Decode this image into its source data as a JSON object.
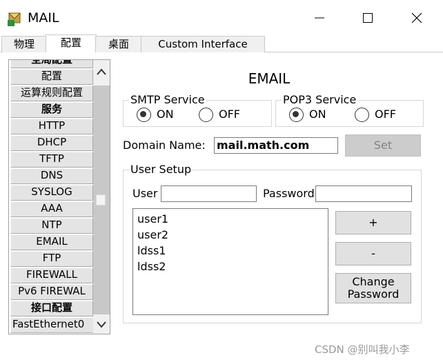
{
  "window": {
    "title": "MAIL"
  },
  "tabs": [
    {
      "label": "物理"
    },
    {
      "label": "配置"
    },
    {
      "label": "桌面"
    },
    {
      "label": "Custom Interface"
    }
  ],
  "sidebar": {
    "items": [
      {
        "label": "全局配置"
      },
      {
        "label": "配置"
      },
      {
        "label": "运算规则配置"
      },
      {
        "label": "服务"
      },
      {
        "label": "HTTP"
      },
      {
        "label": "DHCP"
      },
      {
        "label": "TFTP"
      },
      {
        "label": "DNS"
      },
      {
        "label": "SYSLOG"
      },
      {
        "label": "AAA"
      },
      {
        "label": "NTP"
      },
      {
        "label": "EMAIL"
      },
      {
        "label": "FTP"
      },
      {
        "label": "FIREWALL"
      },
      {
        "label": "Pv6 FIREWAL"
      },
      {
        "label": "接口配置"
      },
      {
        "label": "FastEthernet0"
      }
    ]
  },
  "email": {
    "title": "EMAIL",
    "smtp": {
      "legend": "SMTP Service",
      "on_label": "ON",
      "off_label": "OFF"
    },
    "pop3": {
      "legend": "POP3 Service",
      "on_label": "ON",
      "off_label": "OFF"
    },
    "domain": {
      "label": "Domain Name:",
      "value": "mail.math.com",
      "set_label": "Set"
    },
    "user_setup": {
      "legend": "User Setup",
      "user_label": "User",
      "user_value": "",
      "password_label": "Password",
      "password_value": "",
      "users": [
        "user1",
        "user2",
        "ldss1",
        "ldss2"
      ],
      "add_label": "+",
      "remove_label": "-",
      "change_password_line1": "Change",
      "change_password_line2": "Password"
    }
  },
  "watermark": "CSDN @别叫我小李"
}
